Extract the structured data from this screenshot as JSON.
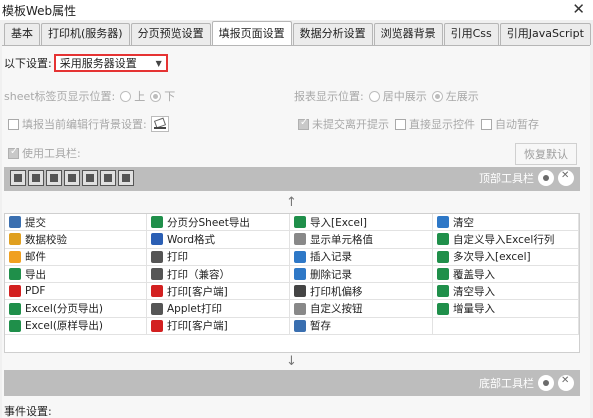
{
  "window": {
    "title": "模板Web属性",
    "close": "✕"
  },
  "tabs": [
    "基本",
    "打印机(服务器)",
    "分页预览设置",
    "填报页面设置",
    "数据分析设置",
    "浏览器背景",
    "引用Css",
    "引用JavaScript"
  ],
  "active_tab": 3,
  "settings": {
    "mode_label": "以下设置:",
    "mode_value": "采用服务器设置",
    "sheet_label": "sheet标签页显示位置:",
    "sheet_top": "上",
    "sheet_bottom": "下",
    "report_label": "报表显示位置:",
    "report_center": "居中展示",
    "report_left": "左展示",
    "fill_bg_label": "填报当前编辑行背景设置:",
    "unsubmitted": "未提交离开提示",
    "direct_widget": "直接显示控件",
    "auto_save": "自动暂存",
    "use_toolbar": "使用工具栏:",
    "reset": "恢复默认"
  },
  "top_toolbar": {
    "label": "顶部工具栏"
  },
  "bottom_toolbar": {
    "label": "底部工具栏"
  },
  "arrows": {
    "up": "↑",
    "down": "↓"
  },
  "tool_items": [
    [
      {
        "label": "提交",
        "icon": "submit-icon",
        "color": "#3a6fb0"
      },
      {
        "label": "分页分Sheet导出",
        "icon": "excel-icon",
        "color": "#1f8f4a"
      },
      {
        "label": "导入[Excel]",
        "icon": "excel-icon",
        "color": "#1f8f4a"
      },
      {
        "label": "清空",
        "icon": "eraser-icon",
        "color": "#2e78c7"
      }
    ],
    [
      {
        "label": "数据校验",
        "icon": "verify-icon",
        "color": "#e0a020"
      },
      {
        "label": "Word格式",
        "icon": "word-icon",
        "color": "#2b5fb4"
      },
      {
        "label": "显示单元格值",
        "icon": "cell-icon",
        "color": "#888888"
      },
      {
        "label": "自定义导入Excel行列",
        "icon": "excel-icon",
        "color": "#1f8f4a"
      }
    ],
    [
      {
        "label": "邮件",
        "icon": "mail-icon",
        "color": "#f0a020"
      },
      {
        "label": "打印",
        "icon": "print-icon",
        "color": "#555555"
      },
      {
        "label": "插入记录",
        "icon": "insert-icon",
        "color": "#2e78c7"
      },
      {
        "label": "多次导入[excel]",
        "icon": "excel-icon",
        "color": "#1f8f4a"
      }
    ],
    [
      {
        "label": "导出",
        "icon": "export-icon",
        "color": "#1f8f4a"
      },
      {
        "label": "打印（兼容）",
        "icon": "print-icon",
        "color": "#555555"
      },
      {
        "label": "删除记录",
        "icon": "delete-icon",
        "color": "#2e78c7"
      },
      {
        "label": "覆盖导入",
        "icon": "excel-icon",
        "color": "#1f8f4a"
      }
    ],
    [
      {
        "label": "PDF",
        "icon": "pdf-icon",
        "color": "#d32020"
      },
      {
        "label": "打印[客户端]",
        "icon": "print-client-icon",
        "color": "#d32020"
      },
      {
        "label": "打印机偏移",
        "icon": "move-icon",
        "color": "#444444"
      },
      {
        "label": "清空导入",
        "icon": "excel-icon",
        "color": "#1f8f4a"
      }
    ],
    [
      {
        "label": "Excel(分页导出)",
        "icon": "excel-icon",
        "color": "#1f8f4a"
      },
      {
        "label": "Applet打印",
        "icon": "applet-icon",
        "color": "#555555"
      },
      {
        "label": "自定义按钮",
        "icon": "gear-icon",
        "color": "#888888"
      },
      {
        "label": "增量导入",
        "icon": "excel-icon",
        "color": "#1f8f4a"
      }
    ],
    [
      {
        "label": "Excel(原样导出)",
        "icon": "excel-icon",
        "color": "#1f8f4a"
      },
      {
        "label": "打印[客户端]",
        "icon": "print-client-icon",
        "color": "#d32020"
      },
      {
        "label": "暂存",
        "icon": "save-icon",
        "color": "#3a6fb0"
      },
      {
        "label": "",
        "icon": "",
        "color": ""
      }
    ]
  ],
  "events_label": "事件设置:"
}
